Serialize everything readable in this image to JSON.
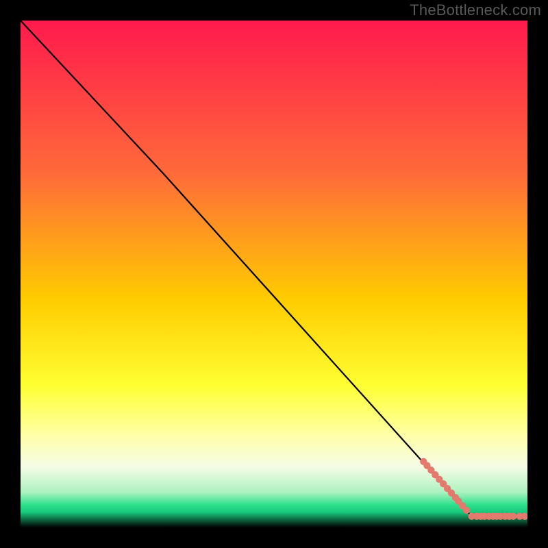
{
  "watermark": "TheBottleneck.com",
  "chart_data": {
    "type": "line",
    "title": "",
    "xlabel": "",
    "ylabel": "",
    "xlim": [
      0,
      100
    ],
    "ylim": [
      0,
      100
    ],
    "grid": false,
    "background": {
      "gradient_stops": [
        {
          "offset": 0.0,
          "color": "#ff1a4d"
        },
        {
          "offset": 0.3,
          "color": "#ff6a3a"
        },
        {
          "offset": 0.55,
          "color": "#ffcc00"
        },
        {
          "offset": 0.72,
          "color": "#ffff33"
        },
        {
          "offset": 0.82,
          "color": "#ffffaa"
        },
        {
          "offset": 0.88,
          "color": "#f5fce6"
        },
        {
          "offset": 0.93,
          "color": "#aef2c0"
        },
        {
          "offset": 0.955,
          "color": "#2fe08c"
        },
        {
          "offset": 0.97,
          "color": "#17c97c"
        },
        {
          "offset": 1.0,
          "color": "#000000"
        }
      ]
    },
    "series": [
      {
        "name": "curve",
        "type": "line",
        "color": "#000000",
        "x": [
          0,
          28,
          89,
          100
        ],
        "y": [
          100,
          70,
          2.2,
          2.2
        ]
      },
      {
        "name": "markers-descending",
        "type": "scatter",
        "color": "#e47a6e",
        "x": [
          79.5,
          80.2,
          81.0,
          81.8,
          82.6,
          83.4,
          84.2,
          85.0,
          85.8,
          86.4,
          87.2,
          88.0
        ],
        "y": [
          13.0,
          12.2,
          11.3,
          10.4,
          9.5,
          8.6,
          7.7,
          6.8,
          5.9,
          5.2,
          4.3,
          3.4
        ]
      },
      {
        "name": "markers-bottom",
        "type": "scatter",
        "color": "#e47a6e",
        "x": [
          89.0,
          90.0,
          90.8,
          91.5,
          92.4,
          93.2,
          93.9,
          94.7,
          95.6,
          96.4,
          97.2,
          98.5,
          99.5
        ],
        "y": [
          2.2,
          2.2,
          2.2,
          2.2,
          2.2,
          2.2,
          2.2,
          2.2,
          2.2,
          2.2,
          2.2,
          2.2,
          2.2
        ]
      }
    ]
  }
}
